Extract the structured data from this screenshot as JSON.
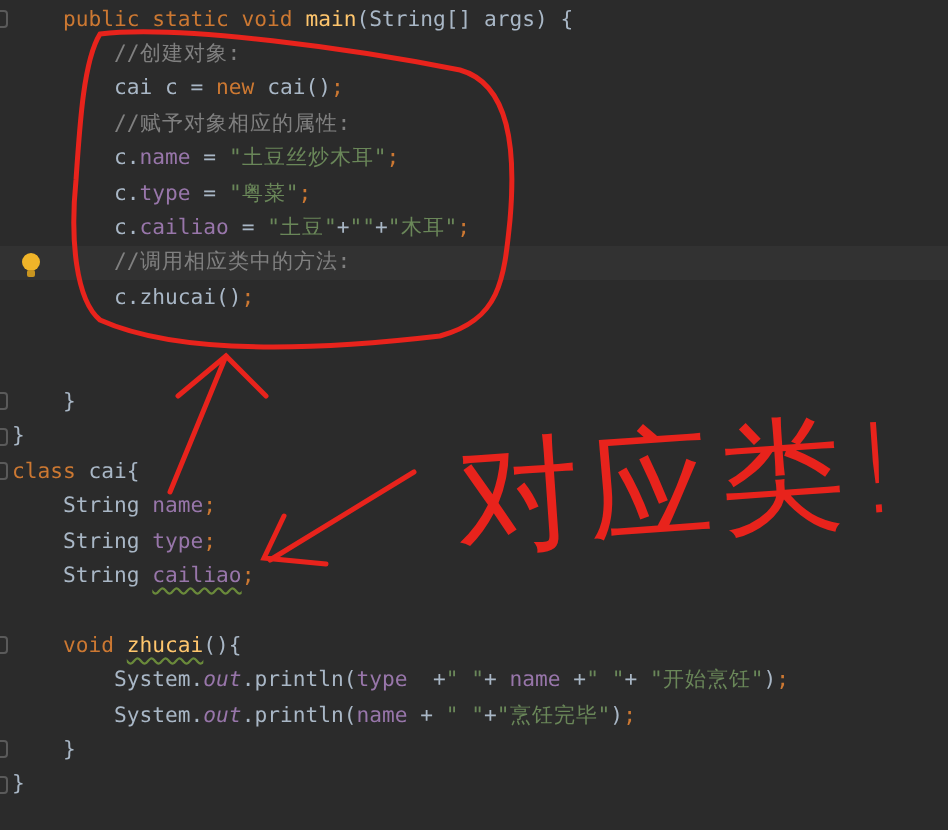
{
  "editor": {
    "lines": [
      {
        "kind": "block",
        "children": [
          {
            "kind": "code",
            "fold": true,
            "tokens": [
              {
                "text": "public static void ",
                "kind": "keyword"
              },
              {
                "text": "main",
                "kind": "method"
              },
              {
                "text": "(String[] args) {",
                "kind": "plain"
              }
            ],
            "children": [
              {
                "kind": "code",
                "tokens": [
                  {
                    "text": "//创建对象:",
                    "kind": "comment"
                  }
                ]
              },
              {
                "kind": "code",
                "tokens": [
                  {
                    "text": "cai c = ",
                    "kind": "plain"
                  },
                  {
                    "text": "new ",
                    "kind": "keyword"
                  },
                  {
                    "text": "cai()",
                    "kind": "plain"
                  },
                  {
                    "text": ";",
                    "kind": "keyword"
                  }
                ]
              },
              {
                "kind": "code",
                "tokens": [
                  {
                    "text": "//赋予对象相应的属性:",
                    "kind": "comment"
                  }
                ]
              },
              {
                "kind": "code",
                "tokens": [
                  {
                    "text": "c.",
                    "kind": "plain"
                  },
                  {
                    "text": "name",
                    "kind": "field"
                  },
                  {
                    "text": " = ",
                    "kind": "plain"
                  },
                  {
                    "text": "\"土豆丝炒木耳\"",
                    "kind": "string"
                  },
                  {
                    "text": ";",
                    "kind": "keyword"
                  }
                ]
              },
              {
                "kind": "code",
                "tokens": [
                  {
                    "text": "c.",
                    "kind": "plain"
                  },
                  {
                    "text": "type",
                    "kind": "field"
                  },
                  {
                    "text": " = ",
                    "kind": "plain"
                  },
                  {
                    "text": "\"粤菜\"",
                    "kind": "string"
                  },
                  {
                    "text": ";",
                    "kind": "keyword"
                  }
                ]
              },
              {
                "kind": "code",
                "tokens": [
                  {
                    "text": "c.",
                    "kind": "plain"
                  },
                  {
                    "text": "cailiao",
                    "kind": "field"
                  },
                  {
                    "text": " = ",
                    "kind": "plain"
                  },
                  {
                    "text": "\"土豆\"",
                    "kind": "string"
                  },
                  {
                    "text": "+",
                    "kind": "plain"
                  },
                  {
                    "text": "\"\"",
                    "kind": "string"
                  },
                  {
                    "text": "+",
                    "kind": "plain"
                  },
                  {
                    "text": "\"木耳\"",
                    "kind": "string"
                  },
                  {
                    "text": ";",
                    "kind": "keyword"
                  }
                ]
              },
              {
                "kind": "code",
                "current": true,
                "hint": true,
                "tokens": [
                  {
                    "text": "//调用相应类中的方法:",
                    "kind": "comment"
                  }
                ]
              },
              {
                "kind": "code",
                "tokens": [
                  {
                    "text": "c.zhucai()",
                    "kind": "plain"
                  },
                  {
                    "text": ";",
                    "kind": "keyword"
                  }
                ]
              },
              {
                "kind": "blank"
              },
              {
                "kind": "blank"
              }
            ]
          },
          {
            "kind": "code",
            "fold": true,
            "tokens": [
              {
                "text": "}",
                "kind": "plain"
              }
            ]
          }
        ]
      },
      {
        "kind": "code",
        "fold": true,
        "tokens": [
          {
            "text": "}",
            "kind": "plain"
          }
        ]
      },
      {
        "kind": "code",
        "fold": true,
        "tokens": [
          {
            "text": "class ",
            "kind": "keyword"
          },
          {
            "text": "cai{",
            "kind": "plain"
          }
        ],
        "children": [
          {
            "kind": "code",
            "tokens": [
              {
                "text": "String ",
                "kind": "plain"
              },
              {
                "text": "name",
                "kind": "field"
              },
              {
                "text": ";",
                "kind": "keyword"
              }
            ]
          },
          {
            "kind": "code",
            "tokens": [
              {
                "text": "String ",
                "kind": "plain"
              },
              {
                "text": "type",
                "kind": "field"
              },
              {
                "text": ";",
                "kind": "keyword"
              }
            ]
          },
          {
            "kind": "code",
            "tokens": [
              {
                "text": "String ",
                "kind": "plain"
              },
              {
                "text": "cailiao",
                "kind": "field",
                "warning": true
              },
              {
                "text": ";",
                "kind": "keyword"
              }
            ]
          },
          {
            "kind": "blank"
          },
          {
            "kind": "code",
            "fold": true,
            "tokens": [
              {
                "text": "void ",
                "kind": "keyword"
              },
              {
                "text": "zhucai",
                "kind": "method",
                "warning": true
              },
              {
                "text": "(){",
                "kind": "plain"
              }
            ],
            "children": [
              {
                "kind": "code",
                "tokens": [
                  {
                    "text": "System.",
                    "kind": "plain"
                  },
                  {
                    "text": "out",
                    "kind": "static"
                  },
                  {
                    "text": ".println(",
                    "kind": "plain"
                  },
                  {
                    "text": "type",
                    "kind": "field"
                  },
                  {
                    "text": "  +",
                    "kind": "plain"
                  },
                  {
                    "text": "\" \"",
                    "kind": "string"
                  },
                  {
                    "text": "+ ",
                    "kind": "plain"
                  },
                  {
                    "text": "name",
                    "kind": "field"
                  },
                  {
                    "text": " +",
                    "kind": "plain"
                  },
                  {
                    "text": "\" \"",
                    "kind": "string"
                  },
                  {
                    "text": "+ ",
                    "kind": "plain"
                  },
                  {
                    "text": "\"开始烹饪\"",
                    "kind": "string"
                  },
                  {
                    "text": ")",
                    "kind": "plain"
                  },
                  {
                    "text": ";",
                    "kind": "keyword"
                  }
                ]
              },
              {
                "kind": "code",
                "tokens": [
                  {
                    "text": "System.",
                    "kind": "plain"
                  },
                  {
                    "text": "out",
                    "kind": "static"
                  },
                  {
                    "text": ".println(",
                    "kind": "plain"
                  },
                  {
                    "text": "name",
                    "kind": "field"
                  },
                  {
                    "text": " + ",
                    "kind": "plain"
                  },
                  {
                    "text": "\" \"",
                    "kind": "string"
                  },
                  {
                    "text": "+",
                    "kind": "plain"
                  },
                  {
                    "text": "\"烹饪完毕\"",
                    "kind": "string"
                  },
                  {
                    "text": ")",
                    "kind": "plain"
                  },
                  {
                    "text": ";",
                    "kind": "keyword"
                  }
                ]
              }
            ]
          },
          {
            "kind": "code",
            "fold": true,
            "tokens": [
              {
                "text": "}",
                "kind": "plain"
              }
            ]
          }
        ]
      },
      {
        "kind": "code",
        "fold": true,
        "tokens": [
          {
            "text": "}",
            "kind": "plain"
          }
        ]
      }
    ]
  },
  "annotation": {
    "text": "对应类!"
  }
}
